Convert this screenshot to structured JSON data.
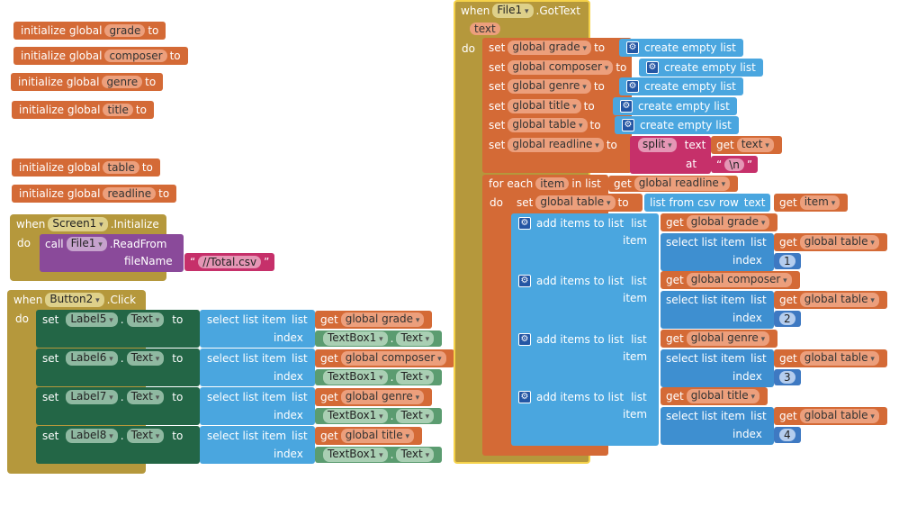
{
  "kw": {
    "init_global": "initialize global",
    "to": "to",
    "when": "when",
    "do": "do",
    "call": "call",
    "set": "set",
    "get": "get",
    "select_list_item": "select list item",
    "list": "list",
    "index": "index",
    "item": "item",
    "create_empty_list": "create empty list",
    "split": "split",
    "text": "text",
    "at": "at",
    "for_each": "for each",
    "in_list": "in list",
    "list_from_csv_row": "list from csv row",
    "add_items_to_list": "add items to list",
    "dot_text": ".",
    "text_prop": "Text"
  },
  "globals": {
    "grade": "grade",
    "composer": "composer",
    "genre": "genre",
    "title": "title",
    "table": "table",
    "readline": "readline"
  },
  "screen_init": {
    "component": "Screen1",
    "event": ".Initialize",
    "call_component": "File1",
    "method": ".ReadFrom",
    "param": "fileName",
    "file": "//Total.csv"
  },
  "button_click": {
    "component": "Button2",
    "event": ".Click",
    "rows": [
      {
        "label": "Label5",
        "var": "global grade",
        "textbox": "TextBox1"
      },
      {
        "label": "Label6",
        "var": "global composer",
        "textbox": "TextBox1"
      },
      {
        "label": "Label7",
        "var": "global genre",
        "textbox": "TextBox1"
      },
      {
        "label": "Label8",
        "var": "global title",
        "textbox": "TextBox1"
      }
    ]
  },
  "gottext": {
    "component": "File1",
    "event": ".GotText",
    "param": "text",
    "sets": [
      "global grade",
      "global composer",
      "global genre",
      "global title",
      "global table"
    ],
    "readline_var": "global readline",
    "split_at": "\\n",
    "loop_var": "item",
    "table_var": "global table",
    "adds": [
      {
        "var": "global grade",
        "index": "1"
      },
      {
        "var": "global composer",
        "index": "2"
      },
      {
        "var": "global genre",
        "index": "3"
      },
      {
        "var": "global title",
        "index": "4"
      }
    ]
  }
}
